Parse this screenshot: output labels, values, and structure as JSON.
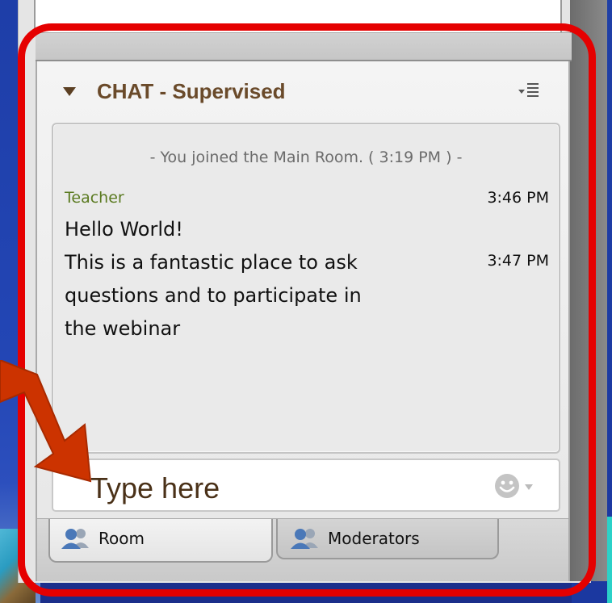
{
  "chat": {
    "title": "CHAT - Supervised",
    "system_message": "- You joined the Main Room. ( 3:19 PM ) -",
    "messages": [
      {
        "sender": "Teacher",
        "time": "3:46 PM",
        "text": "Hello World!"
      },
      {
        "time": "3:47 PM",
        "lines": [
          "This is a fantastic place to ask",
          "questions and to participate in",
          "the webinar"
        ]
      }
    ],
    "input": {
      "placeholder": "Type here"
    }
  },
  "tabs": [
    {
      "label": "Room",
      "icon": "users-icon",
      "active": true
    },
    {
      "label": "Moderators",
      "icon": "users-icon",
      "active": false
    }
  ],
  "colors": {
    "title": "#6a4a2a",
    "sender": "#5a7a20",
    "annotation": "#e50000",
    "slide_background": "#1f3fa6"
  }
}
